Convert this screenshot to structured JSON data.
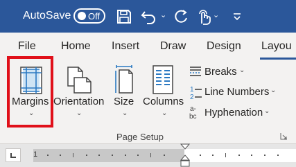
{
  "titlebar": {
    "autosave_label": "AutoSave",
    "autosave_state": "Off"
  },
  "tabs": [
    {
      "label": "File"
    },
    {
      "label": "Home"
    },
    {
      "label": "Insert"
    },
    {
      "label": "Draw"
    },
    {
      "label": "Design"
    },
    {
      "label": "Layou",
      "active": true
    }
  ],
  "ribbon": {
    "margins_label": "Margins",
    "orientation_label": "Orientation",
    "size_label": "Size",
    "columns_label": "Columns",
    "breaks_label": "Breaks",
    "line_numbers_label": "Line Numbers",
    "hyphenation_label": "Hyphenation",
    "group_label": "Page Setup"
  },
  "ruler": {
    "number": "1"
  },
  "colors": {
    "title_bar": "#2b579a",
    "highlight": "#e0101a",
    "accent": "#2b579a"
  }
}
